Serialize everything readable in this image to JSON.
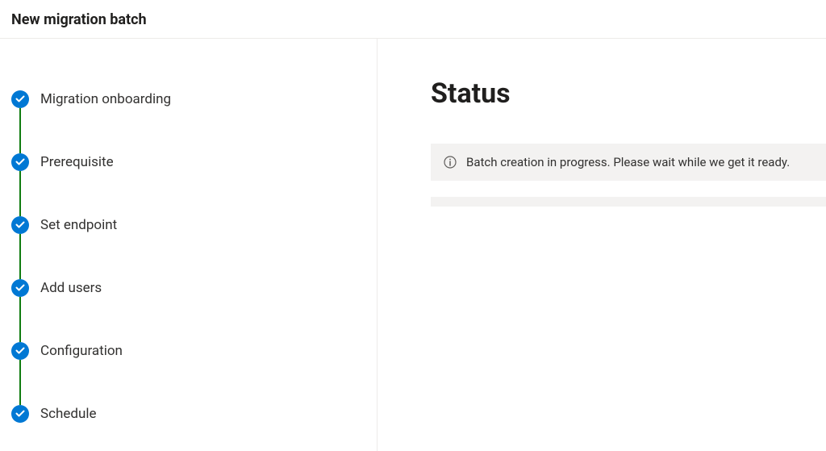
{
  "header": {
    "title": "New migration batch"
  },
  "sidebar": {
    "steps": [
      {
        "label": "Migration onboarding",
        "completed": true
      },
      {
        "label": "Prerequisite",
        "completed": true
      },
      {
        "label": "Set endpoint",
        "completed": true
      },
      {
        "label": "Add users",
        "completed": true
      },
      {
        "label": "Configuration",
        "completed": true
      },
      {
        "label": "Schedule",
        "completed": true
      }
    ]
  },
  "main": {
    "heading": "Status",
    "message": "Batch creation in progress. Please wait while we get it ready."
  },
  "colors": {
    "accent": "#0078d4",
    "success": "#107c10",
    "neutralLight": "#f3f2f1",
    "border": "#edebe9",
    "text": "#323130",
    "heading": "#201f1e"
  }
}
